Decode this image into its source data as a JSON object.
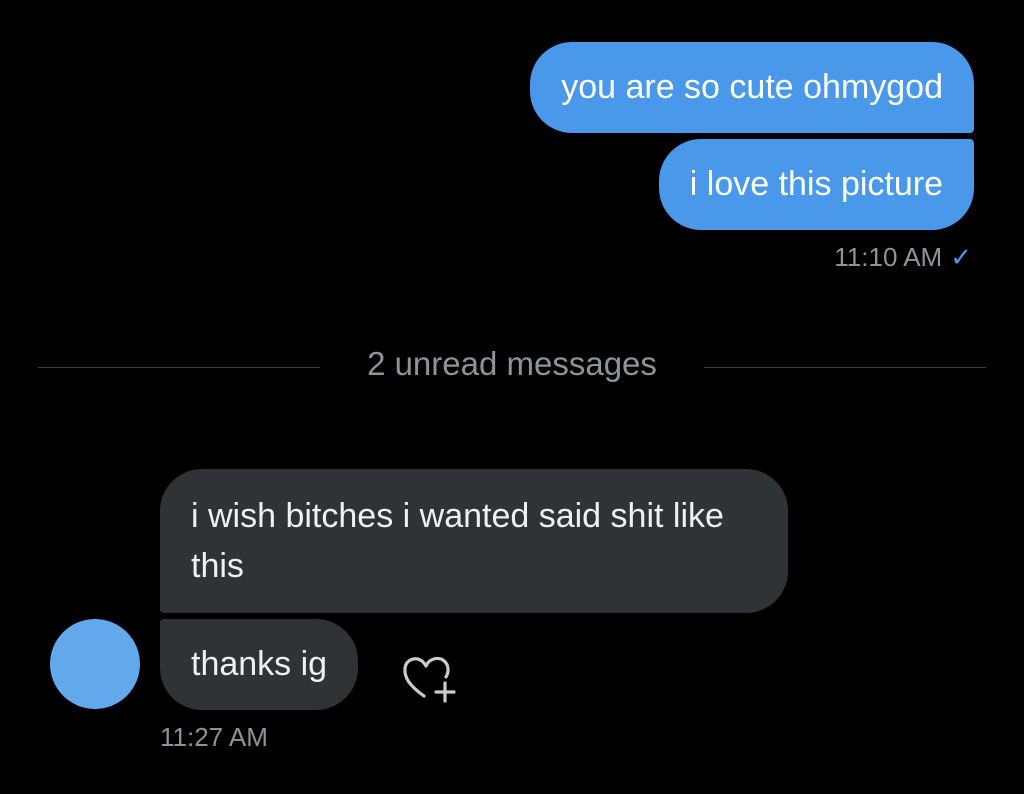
{
  "conversation": {
    "sent_messages": [
      {
        "text": "you are so cute ohmygod"
      },
      {
        "text": "i love this picture"
      }
    ],
    "sent_timestamp": "11:10 AM",
    "read_receipt_icon": "checkmark-icon",
    "unread_divider": "2 unread messages",
    "received_messages": [
      {
        "text": "i wish bitches i wanted said shit like this"
      },
      {
        "text": "thanks ig"
      }
    ],
    "received_timestamp": "11:27 AM",
    "react_icon": "add-reaction-heart-icon"
  },
  "colors": {
    "background": "#000000",
    "sent_bubble": "#4a98e9",
    "received_bubble": "#2f3336",
    "avatar": "#62a8ec",
    "muted_text": "#8b949c"
  }
}
